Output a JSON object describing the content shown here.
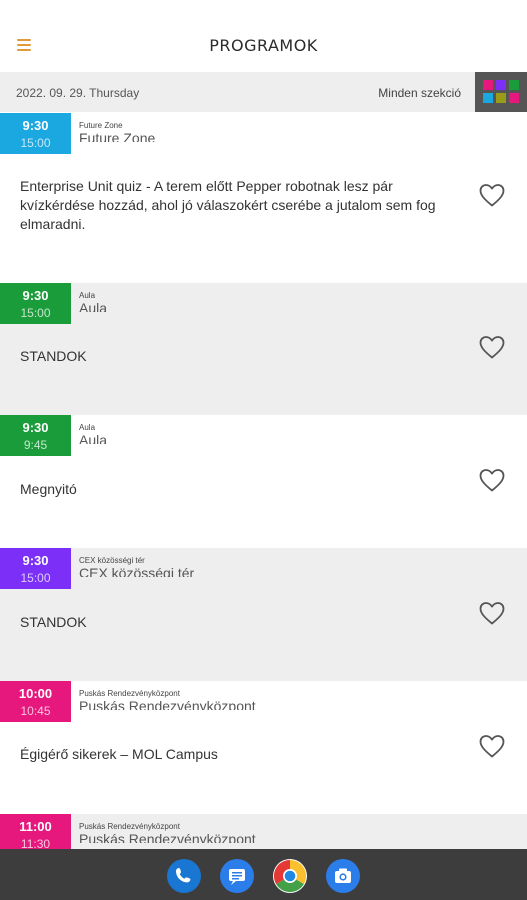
{
  "header": {
    "title": "PROGRAMOK",
    "menu_icon": "hamburger-icon"
  },
  "datebar": {
    "date": "2022. 09. 29. Thursday",
    "section_filter": "Minden szekció",
    "grid_colors": [
      "#e6187e",
      "#7b2ff7",
      "#1a9c3a",
      "#1ba8e0",
      "#9b9b1a",
      "#e6187e"
    ]
  },
  "events": [
    {
      "start": "9:30",
      "end": "15:00",
      "color": "#1ba8e0",
      "bg": "#ffffff",
      "location": "Future Zone",
      "title": "Enterprise Unit quiz - A terem előtt Pepper robotnak lesz pár kvízkérdése hozzád, ahol jó válaszokért cserébe a jutalom sem fog elmaradni."
    },
    {
      "start": "9:30",
      "end": "15:00",
      "color": "#1a9c3a",
      "bg": "#eeeeee",
      "location": "Aula",
      "title": "STANDOK"
    },
    {
      "start": "9:30",
      "end": "9:45",
      "color": "#1a9c3a",
      "bg": "#ffffff",
      "location": "Aula",
      "title": "Megnyitó"
    },
    {
      "start": "9:30",
      "end": "15:00",
      "color": "#7b2ff7",
      "bg": "#eeeeee",
      "location": "CEX közösségi tér",
      "title": "STANDOK"
    },
    {
      "start": "10:00",
      "end": "10:45",
      "color": "#e6187e",
      "bg": "#ffffff",
      "location": "Puskás Rendezvényközpont",
      "title": "Égigérő sikerek – MOL Campus"
    },
    {
      "start": "11:00",
      "end": "11:30",
      "color": "#e6187e",
      "bg": "#eeeeee",
      "location": "Puskás Rendezvényközpont",
      "title": ""
    }
  ],
  "navbar": {
    "icons": [
      "phone-icon",
      "messages-icon",
      "chrome-icon",
      "camera-icon"
    ]
  }
}
